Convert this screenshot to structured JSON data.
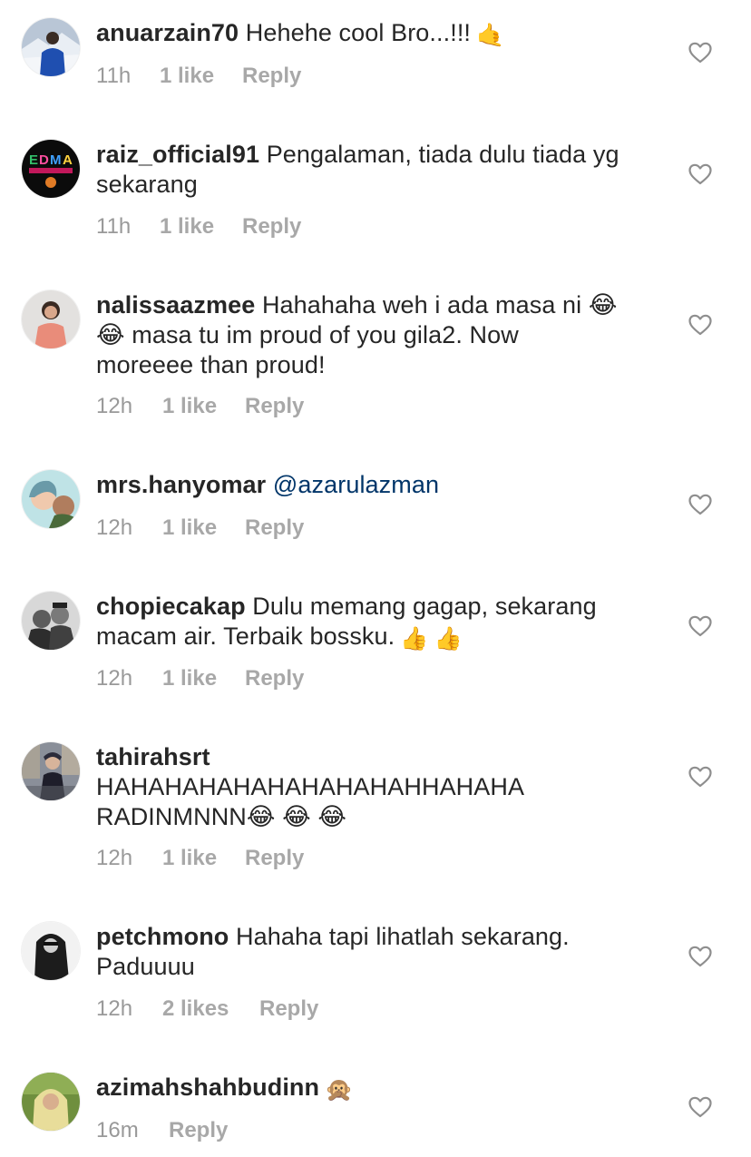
{
  "comments": [
    {
      "username": "anuarzain70",
      "text": "Hehehe cool Bro...!!!",
      "emojis": [
        "🤙"
      ],
      "time": "11h",
      "likes": "1 like",
      "reply": "Reply",
      "avatar_icon": "person-in-snow-avatar"
    },
    {
      "username": "raiz_official91",
      "text": "Pengalaman, tiada dulu tiada yg\nsekarang",
      "emojis": [],
      "time": "11h",
      "likes": "1 like",
      "reply": "Reply",
      "avatar_icon": "edma-2018-logo-avatar"
    },
    {
      "username": "nalissaazmee",
      "text": "Hahahaha weh i ada masa ni 😂\n😂 masa tu im proud of you gila2. Now\nmoreeee than proud!",
      "emojis": [],
      "time": "12h",
      "likes": "1 like",
      "reply": "Reply",
      "avatar_icon": "woman-portrait-avatar"
    },
    {
      "username": "mrs.hanyomar",
      "text": "",
      "mention": "@azarulazman",
      "emojis": [],
      "time": "12h",
      "likes": "1 like",
      "reply": "Reply",
      "avatar_icon": "selfie-avatar"
    },
    {
      "username": "chopiecakap",
      "text": "Dulu memang gagap, sekarang\nmacam air. Terbaik bossku.",
      "emojis": [
        "👍",
        "👍"
      ],
      "time": "12h",
      "likes": "1 like",
      "reply": "Reply",
      "avatar_icon": "group-photo-avatar"
    },
    {
      "username": "tahirahsrt",
      "text": "\nHAHAHAHAHAHAHAHAHAHHAHAHA\nRADINMNNN😂 😂 😂",
      "emojis": [],
      "time": "12h",
      "likes": "1 like",
      "reply": "Reply",
      "avatar_icon": "city-street-avatar"
    },
    {
      "username": "petchmono",
      "text": "Hahaha tapi lihatlah sekarang.\nPaduuuu",
      "emojis": [],
      "time": "12h",
      "likes": "2 likes",
      "reply": "Reply",
      "avatar_icon": "black-white-portrait-avatar"
    },
    {
      "username": "azimahshahbudinn",
      "text": "",
      "emojis": [
        "🙊"
      ],
      "time": "16m",
      "likes": "",
      "reply": "Reply",
      "avatar_icon": "hijab-woman-avatar"
    }
  ],
  "colors": {
    "text": "#262626",
    "meta": "#999999",
    "mention": "#003569",
    "heart_stroke": "#8e8e8e"
  },
  "icons": {
    "like": "heart-outline-icon"
  }
}
